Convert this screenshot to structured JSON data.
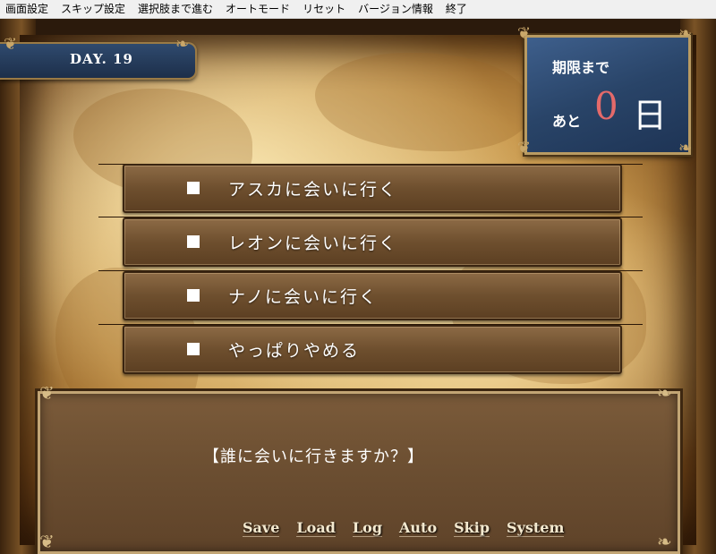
{
  "menu": [
    "画面設定",
    "スキップ設定",
    "選択肢まで進む",
    "オートモード",
    "リセット",
    "バージョン情報",
    "終了"
  ],
  "day_label": "DAY. 19",
  "deadline": {
    "line1": "期限まで",
    "prefix": "あと",
    "number": "0",
    "unit": "日"
  },
  "choices": [
    "アスカに会いに行く",
    "レオンに会いに行く",
    "ナノに会いに行く",
    "やっぱりやめる"
  ],
  "message": "【誰に会いに行きますか？】",
  "system_buttons": [
    "Save",
    "Load",
    "Log",
    "Auto",
    "Skip",
    "System"
  ],
  "colors": {
    "number_accent": "#e46a6a",
    "panel_blue": "#294468",
    "choice_brown": "#6e4f2e"
  }
}
